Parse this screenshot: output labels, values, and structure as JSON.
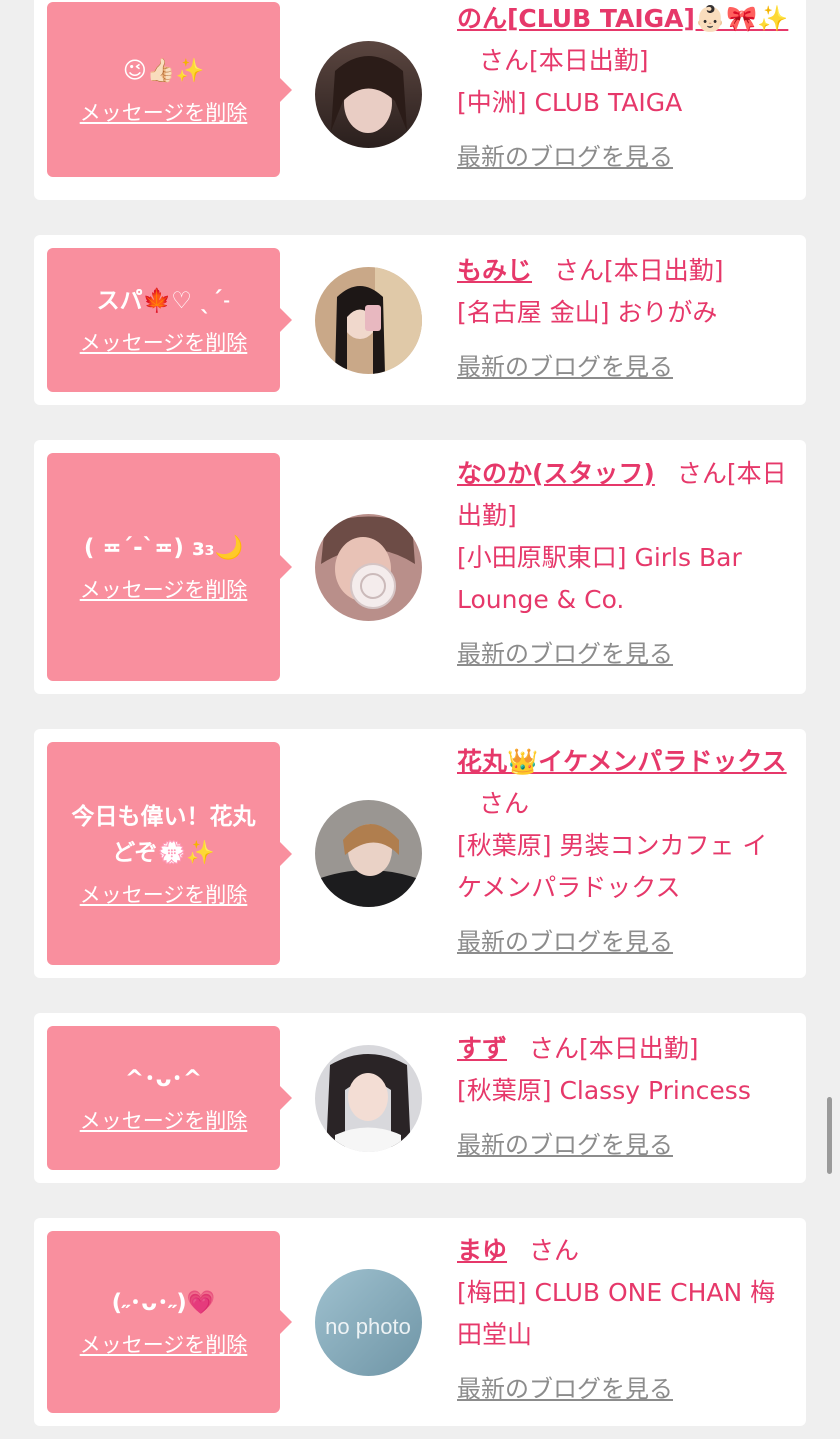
{
  "common": {
    "delete_label": "メッセージを削除",
    "blog_label": "最新のブログを見る",
    "san_suffix": "さん"
  },
  "entries": [
    {
      "message": "😉👍🏻✨",
      "name": "のん[CLUB TAIGA]👶🏻🎀✨",
      "status": "[本日出勤]",
      "shop": "[中洲] CLUB TAIGA",
      "avatar": "photo"
    },
    {
      "message": "スパ🍁♡ ˎˊ˗",
      "name": "もみじ",
      "status": "[本日出勤]",
      "shop": "[名古屋 金山] おりがみ",
      "avatar": "photo"
    },
    {
      "message": "( ≖ˊ-ˋ≖) ɜ₃🌙",
      "name": "なのか(スタッフ)",
      "status": "[本日出勤]",
      "shop": "[小田原駅東口] Girls Bar Lounge & Co.",
      "avatar": "photo"
    },
    {
      "message": "今日も偉い！花丸\nどぞ💮✨",
      "name": "花丸👑イケメンパラドックス",
      "status": "",
      "shop": "[秋葉原] 男装コンカフェ イケメンパラドックス",
      "avatar": "photo"
    },
    {
      "message": "^･ᴗ･^",
      "name": "すず",
      "status": "[本日出勤]",
      "shop": "[秋葉原] Classy Princess",
      "avatar": "photo"
    },
    {
      "message": "(˶･ᴗ･˶)💗",
      "name": "まゆ",
      "status": "",
      "shop": "[梅田] CLUB ONE CHAN 梅田堂山",
      "avatar": "no photo"
    }
  ],
  "colors": {
    "page_bg": "#efefef",
    "card_bg": "#ffffff",
    "bubble_bg": "#f98f9e",
    "accent_text": "#e6386a",
    "muted_link": "#8c8c8c"
  }
}
